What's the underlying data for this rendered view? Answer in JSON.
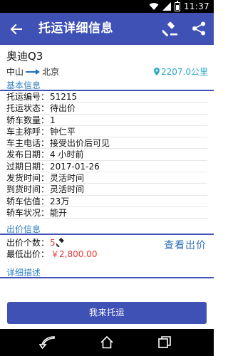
{
  "status_bar": {
    "time": "11:37"
  },
  "app_bar": {
    "title": "托运详细信息"
  },
  "vehicle": {
    "title": "奥迪Q3",
    "origin": "中山",
    "destination": "北京",
    "distance": "2207.0公里"
  },
  "basic_info": {
    "heading": "基本信息",
    "rows": [
      {
        "label": "托运编号：",
        "value": "51215"
      },
      {
        "label": "托运状态：",
        "value": "待出价"
      },
      {
        "label": "轿车数量：",
        "value": "1"
      },
      {
        "label": "车主称呼：",
        "value": "钟仁平"
      },
      {
        "label": "车主电话：",
        "value": "接受出价后可见"
      },
      {
        "label": "发布日期：",
        "value": "4 小时前"
      },
      {
        "label": "过期日期：",
        "value": "2017-01-26"
      },
      {
        "label": "发货时间：",
        "value": "灵活时间"
      },
      {
        "label": "到货时间：",
        "value": "灵活时间"
      },
      {
        "label": "轿车估值：",
        "value": "23万"
      },
      {
        "label": "轿车状况：",
        "value": "能开"
      }
    ]
  },
  "bid_info": {
    "heading": "出价信息",
    "count_label": "出价个数：",
    "count": "5",
    "lowest_label": "最低出价：",
    "lowest_price": "￥2,800.00",
    "view_label": "查看出价"
  },
  "detail": {
    "heading": "详细描述"
  },
  "submit": {
    "label": "我来托运"
  },
  "colors": {
    "primary": "#3f51b5",
    "accent_red": "#e53935",
    "link_blue": "#2e6fb5",
    "distance": "#2aa7c9"
  }
}
